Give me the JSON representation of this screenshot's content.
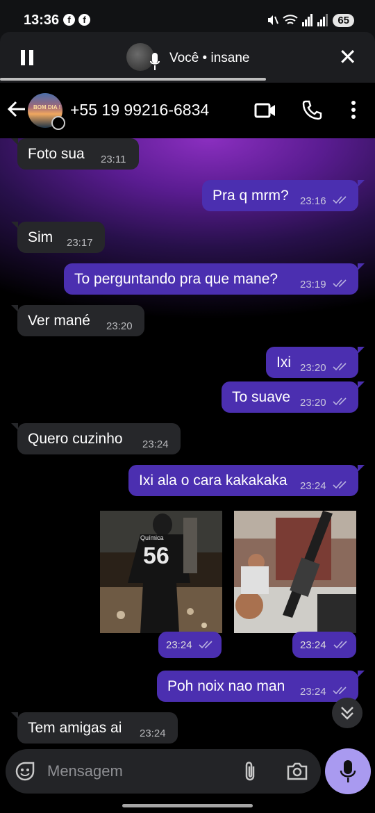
{
  "status_bar": {
    "time": "13:36",
    "battery": "65",
    "icons": [
      "facebook-icon",
      "facebook-icon",
      "mute-icon",
      "wifi-icon",
      "signal-icon",
      "signal-icon"
    ]
  },
  "call": {
    "label": "Você • insane",
    "progress_fraction": 0.71
  },
  "header": {
    "contact_name": "+55 19 99216-6834",
    "avatar_text": "BOM DIA !"
  },
  "messages": [
    {
      "dir": "in",
      "text": "Foto sua",
      "time": "23:11"
    },
    {
      "dir": "out",
      "text": "Pra q mrm?",
      "time": "23:16",
      "ticks": "read"
    },
    {
      "dir": "in",
      "text": "Sim",
      "time": "23:17"
    },
    {
      "dir": "out",
      "text": "To perguntando pra que mane?",
      "time": "23:19",
      "ticks": "read"
    },
    {
      "dir": "in",
      "text": "Ver mané",
      "time": "23:20"
    },
    {
      "dir": "out",
      "text": "Ixi",
      "time": "23:20",
      "ticks": "read"
    },
    {
      "dir": "out",
      "text": "To suave",
      "time": "23:20",
      "ticks": "read"
    },
    {
      "dir": "in",
      "text": "Quero cuzinho",
      "time": "23:24"
    },
    {
      "dir": "out",
      "text": "Ixi ala o cara kakakaka",
      "time": "23:24",
      "ticks": "read"
    },
    {
      "dir": "out",
      "text": "Poh noix nao man",
      "time": "23:24",
      "ticks": "read"
    },
    {
      "dir": "in",
      "text": "Tem amigas ai",
      "time": "23:24"
    }
  ],
  "photos": [
    {
      "time": "23:24",
      "shirt_text": "Química",
      "shirt_number": "56"
    },
    {
      "time": "23:24"
    }
  ],
  "composer": {
    "placeholder": "Mensagem"
  },
  "colors": {
    "outgoing_bubble": "#4b2fb0",
    "incoming_bubble": "#26272a",
    "mic_button": "#a99af0",
    "wallpaper_top": "#8b2fc0"
  }
}
